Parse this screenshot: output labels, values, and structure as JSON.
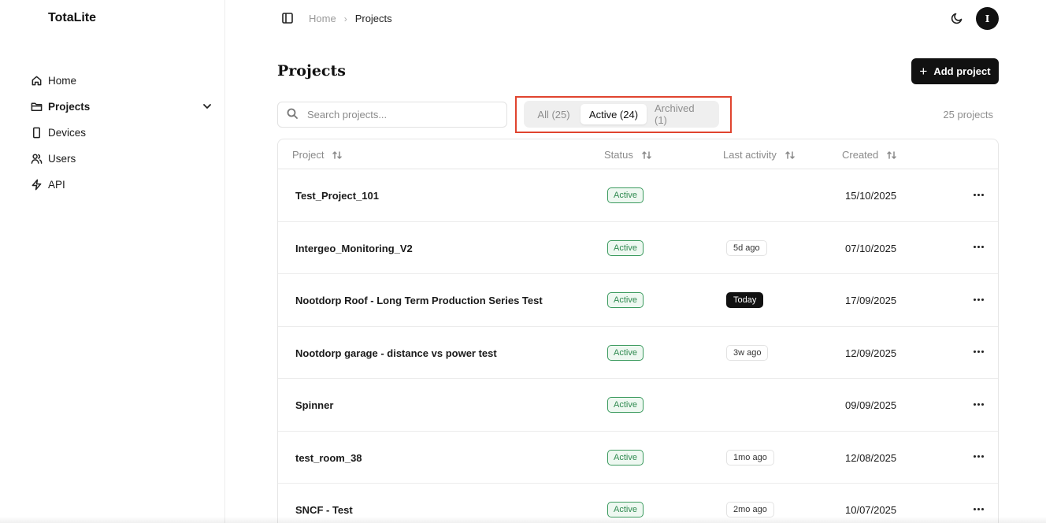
{
  "app": {
    "brand": "TotaLite"
  },
  "sidebar": {
    "items": [
      {
        "label": "Home",
        "icon": "home-icon",
        "active": false
      },
      {
        "label": "Projects",
        "icon": "folder-icon",
        "active": true
      },
      {
        "label": "Devices",
        "icon": "device-icon",
        "active": false
      },
      {
        "label": "Users",
        "icon": "users-icon",
        "active": false
      },
      {
        "label": "API",
        "icon": "lightning-icon",
        "active": false
      }
    ]
  },
  "breadcrumb": {
    "home": "Home",
    "separator": "›",
    "current": "Projects"
  },
  "header": {
    "avatar_initial": "I"
  },
  "page": {
    "title": "Projects",
    "add_button": "Add project",
    "search_placeholder": "Search projects...",
    "project_count": "25 projects"
  },
  "tabs": [
    {
      "label": "All (25)",
      "selected": false
    },
    {
      "label": "Active (24)",
      "selected": true
    },
    {
      "label": "Archived (1)",
      "selected": false
    }
  ],
  "table": {
    "columns": [
      "Project",
      "Status",
      "Last activity",
      "Created"
    ],
    "rows": [
      {
        "name": "Test_Project_101",
        "status": "Active",
        "last_activity": "",
        "created": "15/10/2025"
      },
      {
        "name": "Intergeo_Monitoring_V2",
        "status": "Active",
        "last_activity": "5d ago",
        "created": "07/10/2025"
      },
      {
        "name": "Nootdorp Roof - Long Term Production Series Test",
        "status": "Active",
        "last_activity": "Today",
        "created": "17/09/2025"
      },
      {
        "name": "Nootdorp garage - distance vs power test",
        "status": "Active",
        "last_activity": "3w ago",
        "created": "12/09/2025"
      },
      {
        "name": "Spinner",
        "status": "Active",
        "last_activity": "",
        "created": "09/09/2025"
      },
      {
        "name": "test_room_38",
        "status": "Active",
        "last_activity": "1mo ago",
        "created": "12/08/2025"
      },
      {
        "name": "SNCF - Test",
        "status": "Active",
        "last_activity": "2mo ago",
        "created": "10/07/2025"
      }
    ]
  },
  "colors": {
    "accent": "#111111",
    "status_active": "#2f8a50",
    "highlight_border": "#e0442f"
  }
}
